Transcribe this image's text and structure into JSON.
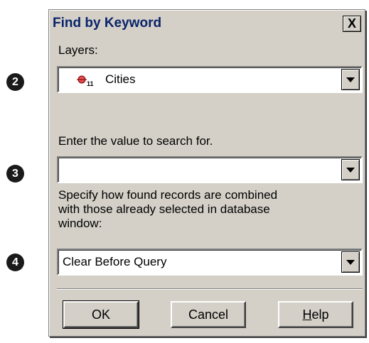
{
  "callouts": [
    "2",
    "3",
    "4"
  ],
  "dialog": {
    "title": "Find by Keyword",
    "close_label": "X",
    "layers_label": "Layers:",
    "layer": {
      "count": "11",
      "name": "Cities",
      "icon": "point-layer-icon"
    },
    "search_label": "Enter the value to search for.",
    "search_value": "",
    "combine_label_line1": "Specify how found records are combined",
    "combine_label_line2": "with those already selected in database",
    "combine_label_line3": "window:",
    "combine_value": "Clear Before Query",
    "buttons": {
      "ok": "OK",
      "cancel": "Cancel",
      "help_first": "H",
      "help_rest": "elp"
    }
  }
}
